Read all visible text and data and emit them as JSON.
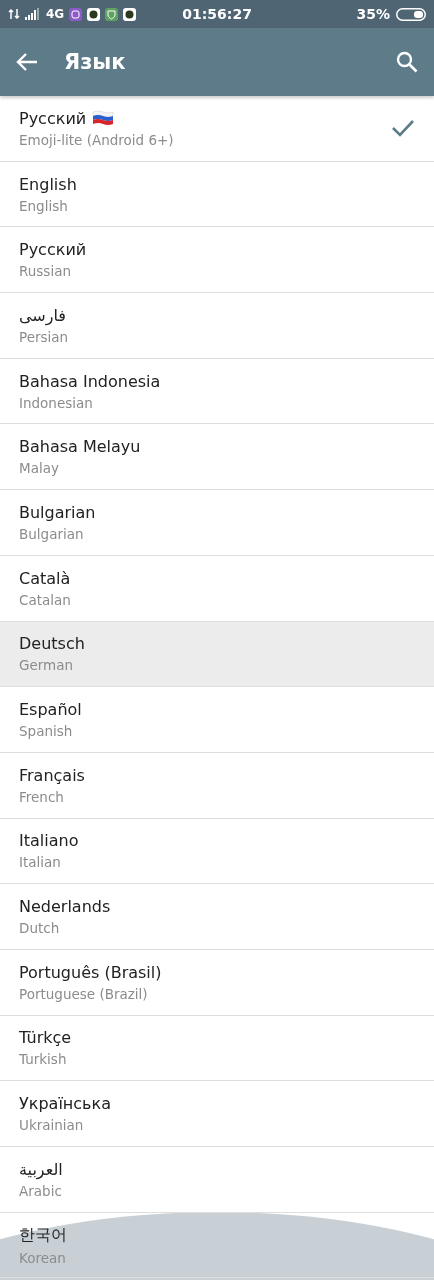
{
  "status_bar": {
    "network": "4G",
    "time": "01:56:27",
    "battery": "35%"
  },
  "header": {
    "title": "Язык"
  },
  "languages": [
    {
      "name": "Русский",
      "subtitle": "Emoji-lite (Android 6+)",
      "flag": true,
      "selected": true,
      "pressed": false
    },
    {
      "name": "English",
      "subtitle": "English",
      "flag": false,
      "selected": false,
      "pressed": false
    },
    {
      "name": "Русский",
      "subtitle": "Russian",
      "flag": false,
      "selected": false,
      "pressed": false
    },
    {
      "name": "فارسی",
      "subtitle": "Persian",
      "flag": false,
      "selected": false,
      "pressed": false
    },
    {
      "name": "Bahasa Indonesia",
      "subtitle": "Indonesian",
      "flag": false,
      "selected": false,
      "pressed": false
    },
    {
      "name": "Bahasa Melayu",
      "subtitle": "Malay",
      "flag": false,
      "selected": false,
      "pressed": false
    },
    {
      "name": "Bulgarian",
      "subtitle": "Bulgarian",
      "flag": false,
      "selected": false,
      "pressed": false
    },
    {
      "name": "Català",
      "subtitle": "Catalan",
      "flag": false,
      "selected": false,
      "pressed": false
    },
    {
      "name": "Deutsch",
      "subtitle": "German",
      "flag": false,
      "selected": false,
      "pressed": true
    },
    {
      "name": "Español",
      "subtitle": "Spanish",
      "flag": false,
      "selected": false,
      "pressed": false
    },
    {
      "name": "Français",
      "subtitle": "French",
      "flag": false,
      "selected": false,
      "pressed": false
    },
    {
      "name": "Italiano",
      "subtitle": "Italian",
      "flag": false,
      "selected": false,
      "pressed": false
    },
    {
      "name": "Nederlands",
      "subtitle": "Dutch",
      "flag": false,
      "selected": false,
      "pressed": false
    },
    {
      "name": "Português (Brasil)",
      "subtitle": "Portuguese (Brazil)",
      "flag": false,
      "selected": false,
      "pressed": false
    },
    {
      "name": "Türkçe",
      "subtitle": "Turkish",
      "flag": false,
      "selected": false,
      "pressed": false
    },
    {
      "name": "Українська",
      "subtitle": "Ukrainian",
      "flag": false,
      "selected": false,
      "pressed": false
    },
    {
      "name": "العربية",
      "subtitle": "Arabic",
      "flag": false,
      "selected": false,
      "pressed": false
    },
    {
      "name": "한국어",
      "subtitle": "Korean",
      "flag": false,
      "selected": false,
      "pressed": false
    }
  ]
}
